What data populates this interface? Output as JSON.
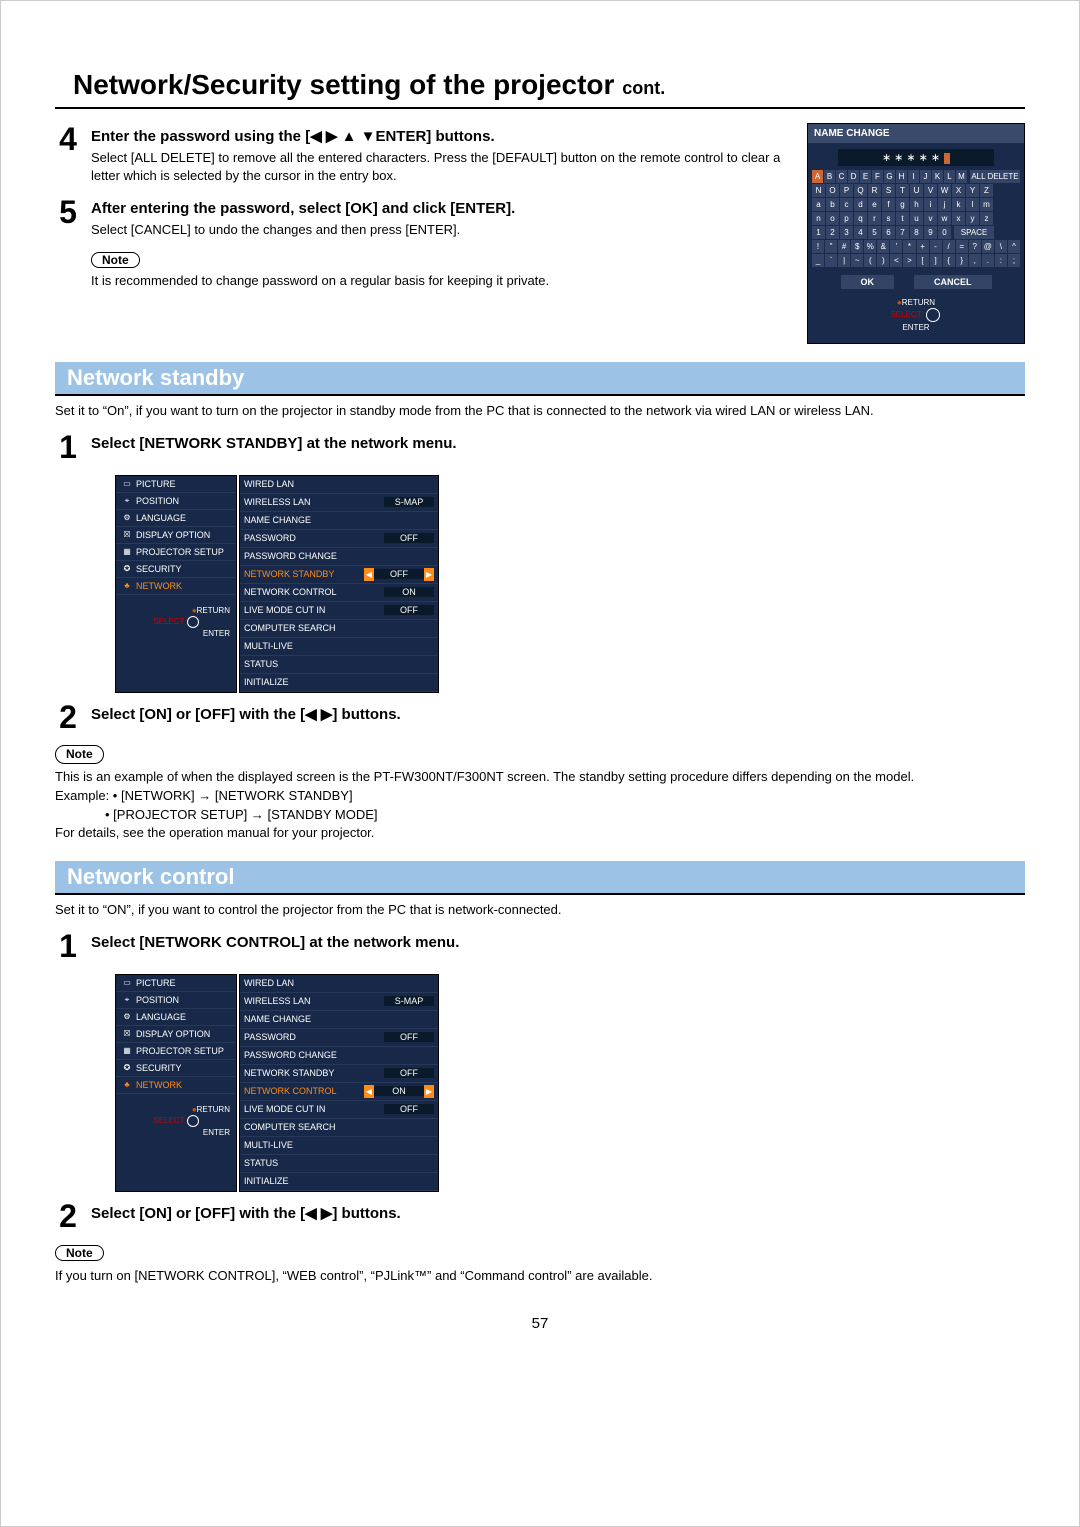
{
  "page_title": "Network/Security setting of the projector",
  "cont": "cont.",
  "steps_top": {
    "s4": {
      "num": "4",
      "title": "Enter the password using the [◀ ▶ ▲ ▼ENTER] buttons.",
      "text": "Select [ALL DELETE] to remove all the entered characters. Press the [DEFAULT] button on the remote control to clear a letter which is selected by the cursor in the entry box."
    },
    "s5": {
      "num": "5",
      "title": "After entering the password, select [OK] and click [ENTER].",
      "text": "Select [CANCEL] to undo the changes and then press [ENTER]."
    },
    "note_label": "Note",
    "note_text": "It is recommended to change password on a regular basis for keeping it private."
  },
  "osk": {
    "title": "NAME CHANGE",
    "field": "∗∗∗∗∗",
    "rows_alpha": [
      [
        "A",
        "B",
        "C",
        "D",
        "E",
        "F",
        "G",
        "H",
        "I",
        "J",
        "K",
        "L",
        "M"
      ],
      [
        "N",
        "O",
        "P",
        "Q",
        "R",
        "S",
        "T",
        "U",
        "V",
        "W",
        "X",
        "Y",
        "Z"
      ],
      [
        "a",
        "b",
        "c",
        "d",
        "e",
        "f",
        "g",
        "h",
        "i",
        "j",
        "k",
        "l",
        "m"
      ],
      [
        "n",
        "o",
        "p",
        "q",
        "r",
        "s",
        "t",
        "u",
        "v",
        "w",
        "x",
        "y",
        "z"
      ]
    ],
    "all_delete": "ALL DELETE",
    "row_num": [
      "1",
      "2",
      "3",
      "4",
      "5",
      "6",
      "7",
      "8",
      "9",
      "0"
    ],
    "space": "SPACE",
    "row_sym1": [
      "!",
      "\"",
      "#",
      "$",
      "%",
      "&",
      "'",
      "*",
      "+",
      "-",
      "/",
      "=",
      "?",
      "@",
      "\\",
      "^"
    ],
    "row_sym2": [
      "_",
      "`",
      "|",
      "~",
      "(",
      ")",
      "<",
      ">",
      "[",
      "]",
      "{",
      "}",
      ",",
      ".",
      ":",
      ";"
    ],
    "ok": "OK",
    "cancel": "CANCEL",
    "hint_return": "RETURN",
    "hint_select": "SELECT",
    "hint_enter": "ENTER"
  },
  "section_standby": {
    "heading": "Network standby",
    "intro": "Set it to “On”, if you want to turn on the projector in standby mode from the PC that is connected to the network via wired LAN or wireless LAN.",
    "step1_num": "1",
    "step1_title": "Select [NETWORK STANDBY] at the network menu.",
    "step2_num": "2",
    "step2_title": "Select [ON] or [OFF] with the [◀ ▶] buttons.",
    "note_label": "Note",
    "note_lines": {
      "l1": "This is an example of when the displayed screen is the PT-FW300NT/F300NT screen. The standby setting procedure differs depending on the model.",
      "l2a": "Example: • [NETWORK] → [NETWORK STANDBY]",
      "l2b": "• [PROJECTOR SETUP] → [STANDBY MODE]",
      "l3": "For details, see the operation manual for your projector."
    }
  },
  "menu_left": {
    "items": [
      {
        "icon": "▭",
        "label": "PICTURE"
      },
      {
        "icon": "⌖",
        "label": "POSITION"
      },
      {
        "icon": "⚙",
        "label": "LANGUAGE"
      },
      {
        "icon": "☒",
        "label": "DISPLAY OPTION"
      },
      {
        "icon": "▦",
        "label": "PROJECTOR SETUP"
      },
      {
        "icon": "✪",
        "label": "SECURITY"
      },
      {
        "icon": "♣",
        "label": "NETWORK",
        "selected": true
      }
    ],
    "hint_return": "RETURN",
    "hint_select": "SELECT",
    "hint_enter": "ENTER"
  },
  "menu_right_standby": [
    {
      "label": "WIRED LAN",
      "val": ""
    },
    {
      "label": "WIRELESS LAN",
      "val": "S-MAP"
    },
    {
      "label": "NAME CHANGE",
      "val": ""
    },
    {
      "label": "PASSWORD",
      "val": "OFF"
    },
    {
      "label": "PASSWORD CHANGE",
      "val": ""
    },
    {
      "label": "NETWORK STANDBY",
      "val": "OFF",
      "hl": true
    },
    {
      "label": "NETWORK CONTROL",
      "val": "ON"
    },
    {
      "label": "LIVE MODE CUT IN",
      "val": "OFF"
    },
    {
      "label": "COMPUTER SEARCH",
      "val": ""
    },
    {
      "label": "MULTI-LIVE",
      "val": ""
    },
    {
      "label": "STATUS",
      "val": ""
    },
    {
      "label": "INITIALIZE",
      "val": ""
    }
  ],
  "section_control": {
    "heading": "Network control",
    "intro": "Set it to “ON”, if you want to control the projector from the PC that is network-connected.",
    "step1_num": "1",
    "step1_title": "Select [NETWORK CONTROL] at the network menu.",
    "step2_num": "2",
    "step2_title": "Select [ON] or [OFF] with the [◀ ▶] buttons.",
    "note_label": "Note",
    "note_text": "If you turn on [NETWORK CONTROL], “WEB control”, “PJLink™” and “Command control” are available."
  },
  "menu_right_control": [
    {
      "label": "WIRED LAN",
      "val": ""
    },
    {
      "label": "WIRELESS LAN",
      "val": "S-MAP"
    },
    {
      "label": "NAME CHANGE",
      "val": ""
    },
    {
      "label": "PASSWORD",
      "val": "OFF"
    },
    {
      "label": "PASSWORD CHANGE",
      "val": ""
    },
    {
      "label": "NETWORK STANDBY",
      "val": "OFF"
    },
    {
      "label": "NETWORK CONTROL",
      "val": "ON",
      "hl": true
    },
    {
      "label": "LIVE MODE CUT IN",
      "val": "OFF"
    },
    {
      "label": "COMPUTER SEARCH",
      "val": ""
    },
    {
      "label": "MULTI-LIVE",
      "val": ""
    },
    {
      "label": "STATUS",
      "val": ""
    },
    {
      "label": "INITIALIZE",
      "val": ""
    }
  ],
  "page_number": "57"
}
